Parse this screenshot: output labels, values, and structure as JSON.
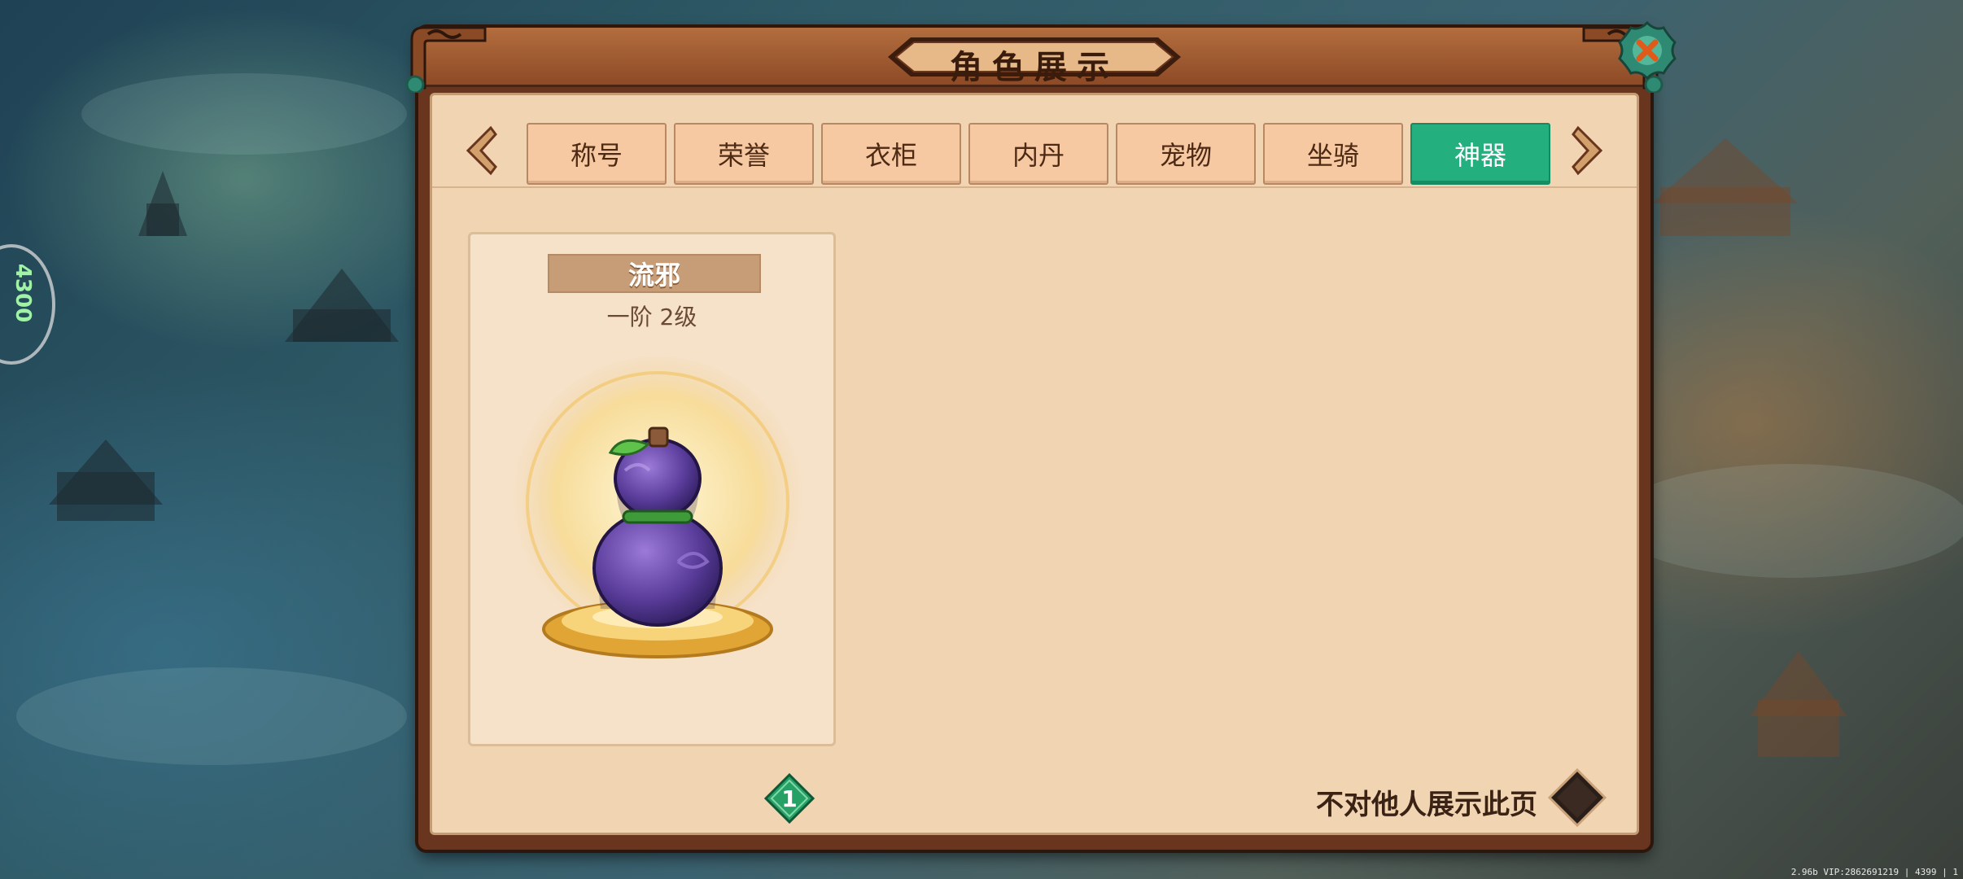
{
  "background": {
    "left_badge_text": "4300",
    "footer_info": "2.96b VIP:2862691219 | 4399 | 1"
  },
  "panel": {
    "title": "角色展示",
    "tabs": [
      {
        "label": "称号",
        "active": false
      },
      {
        "label": "荣誉",
        "active": false
      },
      {
        "label": "衣柜",
        "active": false
      },
      {
        "label": "内丹",
        "active": false
      },
      {
        "label": "宠物",
        "active": false
      },
      {
        "label": "坐骑",
        "active": false
      },
      {
        "label": "神器",
        "active": true
      }
    ]
  },
  "artifact": {
    "name": "流邪",
    "level": "一阶 2级",
    "icon": "purple-gourd-icon"
  },
  "pagination": {
    "current_page": "1"
  },
  "privacy": {
    "label": "不对他人展示此页",
    "checked": false
  },
  "colors": {
    "active_tab": "#23b07e",
    "inactive_tab": "#f7c9a2",
    "panel_frame": "#6a351f",
    "panel_inner": "#f1d5b3",
    "page_badge": "#27a065"
  }
}
